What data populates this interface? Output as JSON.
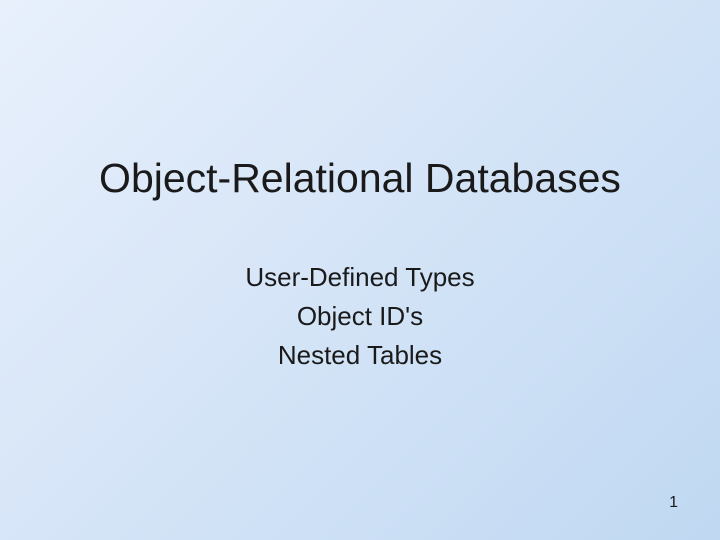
{
  "slide": {
    "title": "Object-Relational Databases",
    "subtitles": [
      "User-Defined Types",
      "Object ID's",
      "Nested Tables"
    ],
    "page_number": "1"
  }
}
